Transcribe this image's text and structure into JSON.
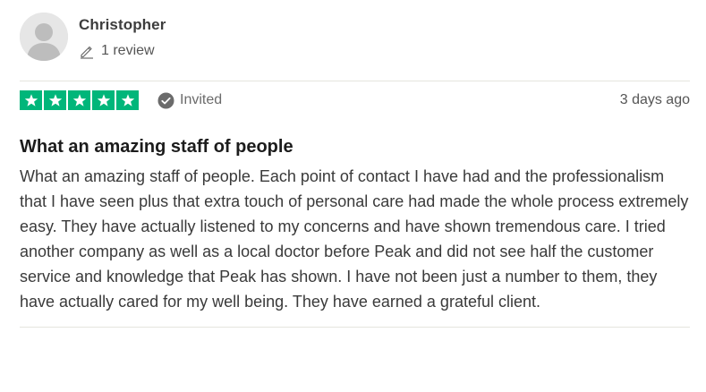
{
  "reviewer": {
    "name": "Christopher",
    "review_count": "1 review",
    "avatar_icon": "person-silhouette-icon",
    "count_icon": "pencil-icon"
  },
  "review": {
    "rating": 5,
    "rating_max": 5,
    "star_color": "#00b67a",
    "badge_label": "Invited",
    "badge_icon": "check-circle-icon",
    "date": "3 days ago",
    "title": "What an amazing staff of people",
    "body": "What an amazing staff of people. Each point of contact I have had and the professionalism that I have seen plus that extra touch of personal care had made the whole process extremely easy. They have actually listened to my concerns and have shown tremendous care. I tried another company as well as a local doctor before Peak and did not see half the customer service and knowledge that Peak has shown. I have not been just a number to them, they have actually cared for my well being. They have earned a grateful client."
  }
}
